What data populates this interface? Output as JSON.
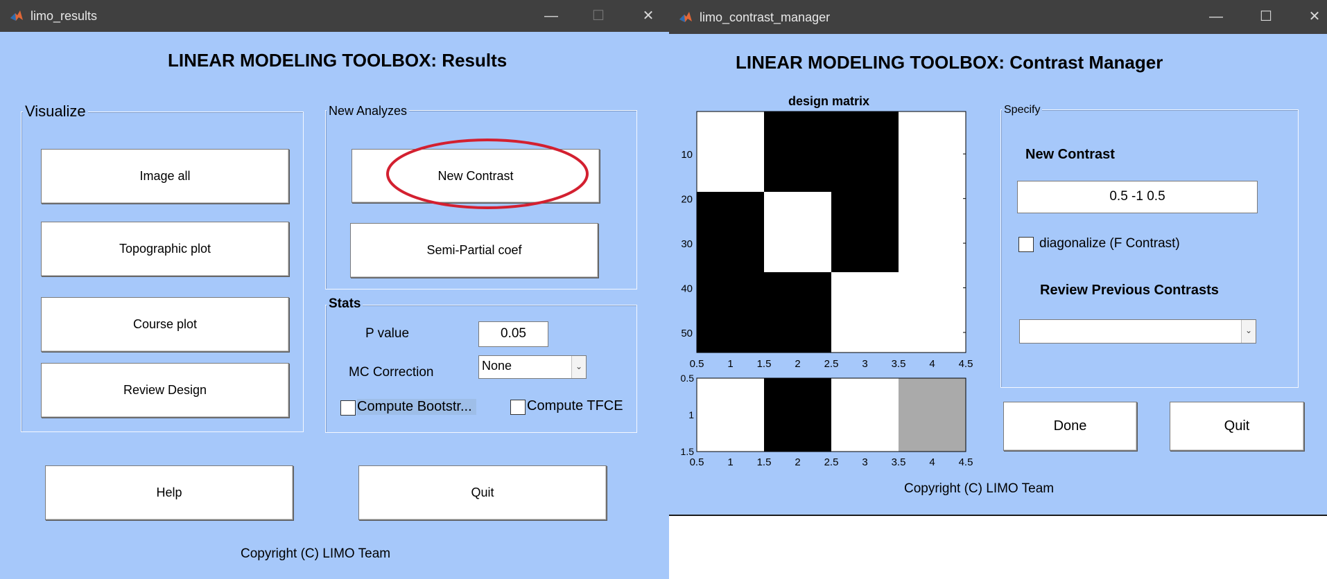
{
  "results_window": {
    "title": "limo_results",
    "heading": "LINEAR MODELING TOOLBOX: Results",
    "visualize": {
      "label": "Visualize",
      "buttons": [
        "Image all",
        "Topographic plot",
        "Course plot",
        "Review Design"
      ]
    },
    "new_analyzes": {
      "label": "New Analyzes",
      "new_contrast": "New Contrast",
      "semi_partial": "Semi-Partial coef"
    },
    "stats": {
      "label": "Stats",
      "p_value_label": "P value",
      "p_value": "0.05",
      "mc_label": "MC Correction",
      "mc_value": "None",
      "bootstrap_label": "Compute Bootstr...",
      "tfce_label": "Compute TFCE"
    },
    "help": "Help",
    "quit": "Quit",
    "copyright": "Copyright (C) LIMO Team"
  },
  "contrast_window": {
    "title": "limo_contrast_manager",
    "heading": "LINEAR MODELING TOOLBOX: Contrast Manager",
    "design_matrix_title": "design matrix",
    "specify": {
      "label": "Specify",
      "new_contrast_label": "New Contrast",
      "new_contrast_value": "0.5 -1 0.5",
      "diagonalize_label": "diagonalize (F Contrast)",
      "review_label": "Review Previous Contrasts",
      "review_value": ""
    },
    "done": "Done",
    "quit": "Quit",
    "copyright": "Copyright (C) LIMO Team"
  },
  "design_matrix": {
    "x_ticks": [
      "0.5",
      "1",
      "1.5",
      "2",
      "2.5",
      "3",
      "3.5",
      "4",
      "4.5"
    ],
    "y_ticks": [
      "10",
      "20",
      "30",
      "40",
      "50"
    ],
    "columns": [
      {
        "column": 1,
        "white_rows": [
          [
            0,
            18
          ]
        ]
      },
      {
        "column": 2,
        "white_rows": [
          [
            18,
            36
          ]
        ]
      },
      {
        "column": 3,
        "white_rows": [
          [
            36,
            54
          ]
        ]
      },
      {
        "column": 4,
        "white_rows": [
          [
            0,
            54
          ]
        ]
      }
    ],
    "rows": 54
  },
  "contrast_plot": {
    "x_ticks": [
      "0.5",
      "1",
      "1.5",
      "2",
      "2.5",
      "3",
      "3.5",
      "4",
      "4.5"
    ],
    "y_ticks": [
      "0.5",
      "1",
      "1.5"
    ],
    "values": [
      0.5,
      -1,
      0.5,
      0
    ]
  },
  "colors": {
    "background": "#a6c8fa",
    "titlebar": "#404040",
    "highlight_ellipse": "#d32030"
  }
}
